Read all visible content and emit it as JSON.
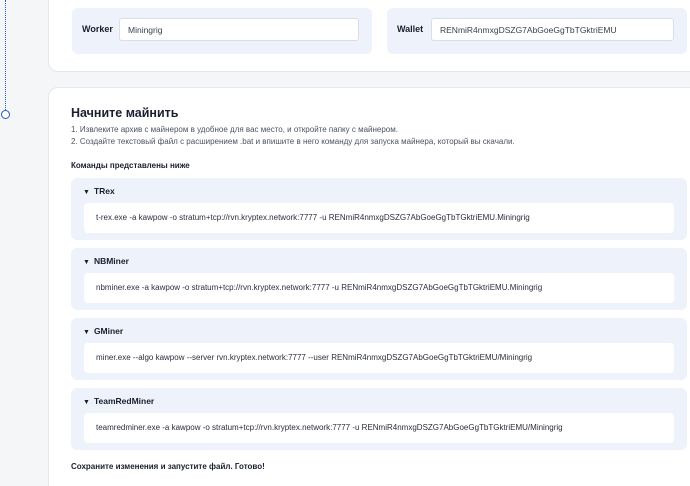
{
  "worker": {
    "label": "Worker",
    "value": "Miningrig"
  },
  "wallet": {
    "label": "Wallet",
    "value": "RENmiR4nmxgDSZG7AbGoeGgTbTGktriEMU"
  },
  "section": {
    "heading": "Начните майнить",
    "step1": "1. Извлеките архив с майнером в удобное для вас место, и откройте папку с майнером.",
    "step2": "2. Создайте текстовый файл с расширением .bat и впишите в него команду для запуска майнера, который вы скачали.",
    "commands_heading": "Команды представлены ниже",
    "miners": [
      {
        "name": "TRex",
        "command": "t-rex.exe -a kawpow -o stratum+tcp://rvn.kryptex.network:7777 -u RENmiR4nmxgDSZG7AbGoeGgTbTGktriEMU.Miningrig"
      },
      {
        "name": "NBMiner",
        "command": "nbminer.exe -a kawpow -o stratum+tcp://rvn.kryptex.network:7777 -u RENmiR4nmxgDSZG7AbGoeGgTbTGktriEMU.Miningrig"
      },
      {
        "name": "GMiner",
        "command": "miner.exe --algo kawpow --server rvn.kryptex.network:7777 --user RENmiR4nmxgDSZG7AbGoeGgTbTGktriEMU/Miningrig"
      },
      {
        "name": "TeamRedMiner",
        "command": "teamredminer.exe -a kawpow -o stratum+tcp://rvn.kryptex.network:7777 -u RENmiR4nmxgDSZG7AbGoeGgTbTGktriEMU/Miningrig"
      }
    ],
    "footer": "Сохраните изменения и запустите файл. Готово!"
  },
  "icons": {
    "expand": "triangle-down-icon"
  },
  "colors": {
    "accent": "#2b55c9",
    "panel": "#eef2fa"
  }
}
